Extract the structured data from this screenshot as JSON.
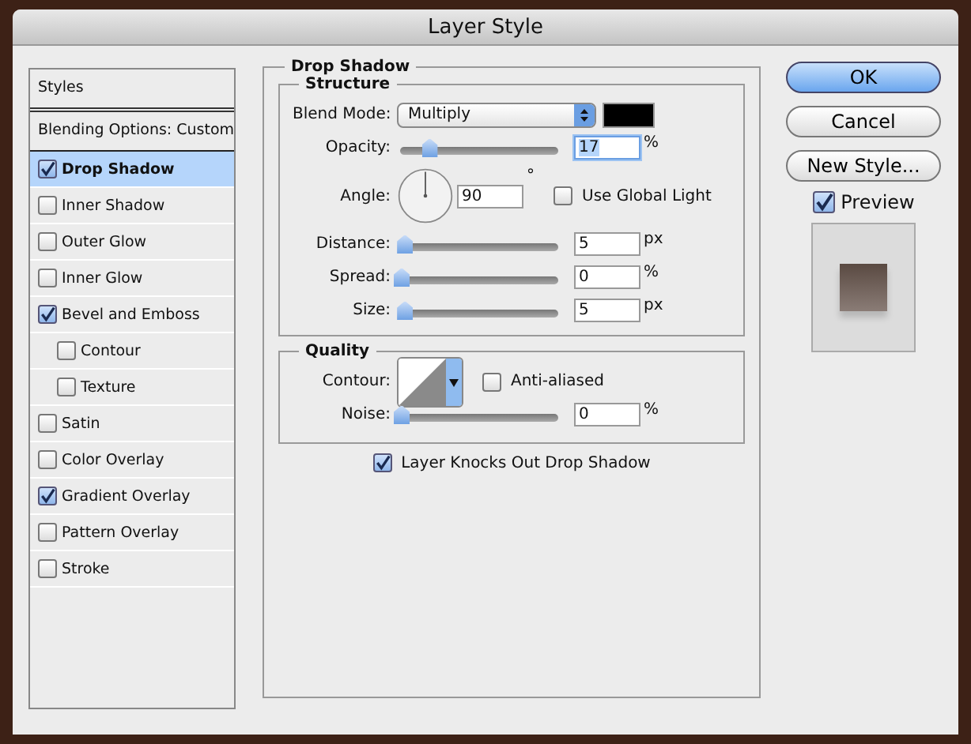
{
  "window": {
    "title": "Layer Style"
  },
  "sidebar": {
    "header": "Styles",
    "blending": "Blending Options: Custom",
    "items": [
      {
        "label": "Drop Shadow",
        "checked": true,
        "selected": true
      },
      {
        "label": "Inner Shadow",
        "checked": false,
        "selected": false
      },
      {
        "label": "Outer Glow",
        "checked": false,
        "selected": false
      },
      {
        "label": "Inner Glow",
        "checked": false,
        "selected": false
      },
      {
        "label": "Bevel and Emboss",
        "checked": true,
        "selected": false,
        "children": [
          {
            "label": "Contour",
            "checked": false,
            "selected": false
          },
          {
            "label": "Texture",
            "checked": false,
            "selected": false
          }
        ]
      },
      {
        "label": "Satin",
        "checked": false,
        "selected": false
      },
      {
        "label": "Color Overlay",
        "checked": false,
        "selected": false
      },
      {
        "label": "Gradient Overlay",
        "checked": true,
        "selected": false
      },
      {
        "label": "Pattern Overlay",
        "checked": false,
        "selected": false
      },
      {
        "label": "Stroke",
        "checked": false,
        "selected": false
      }
    ]
  },
  "panel": {
    "title": "Drop Shadow",
    "structure": {
      "title": "Structure",
      "blend_mode": {
        "label": "Blend Mode:",
        "value": "Multiply",
        "color": "#000000"
      },
      "rows": [
        {
          "kind": "slider",
          "label": "Opacity:",
          "level": 0.17,
          "value": "17",
          "unit": "%",
          "selected": true
        },
        {
          "kind": "angle",
          "label": "Angle:",
          "value": "90",
          "unit": "°",
          "checkbox": {
            "label": "Use Global Light",
            "checked": false
          }
        },
        {
          "kind": "slider",
          "label": "Distance:",
          "level": 0.02,
          "value": "5",
          "unit": "px",
          "selected": false
        },
        {
          "kind": "slider",
          "label": "Spread:",
          "level": 0,
          "value": "0",
          "unit": "%",
          "selected": false
        },
        {
          "kind": "slider",
          "label": "Size:",
          "level": 0.02,
          "value": "5",
          "unit": "px",
          "selected": false
        }
      ]
    },
    "quality": {
      "title": "Quality",
      "contour": {
        "label": "Contour:",
        "anti_aliased": {
          "label": "Anti-aliased",
          "checked": false
        }
      },
      "noise": {
        "label": "Noise:",
        "level": 0,
        "value": "0",
        "unit": "%"
      }
    },
    "knockout": {
      "label": "Layer Knocks Out Drop Shadow",
      "checked": true
    }
  },
  "buttons": [
    {
      "label": "OK",
      "default": true
    },
    {
      "label": "Cancel",
      "default": false
    },
    {
      "label": "New Style...",
      "default": false
    }
  ],
  "preview": {
    "label": "Preview",
    "checked": true
  }
}
